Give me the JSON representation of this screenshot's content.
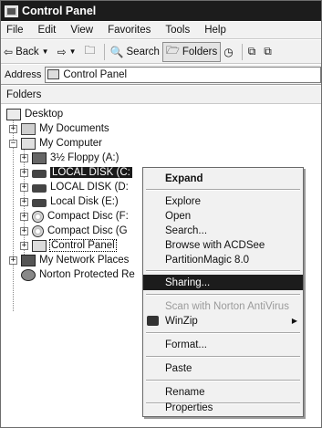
{
  "window": {
    "title": "Control Panel"
  },
  "menubar": {
    "items": [
      "File",
      "Edit",
      "View",
      "Favorites",
      "Tools",
      "Help"
    ]
  },
  "toolbar": {
    "back": "Back",
    "search": "Search",
    "folders": "Folders"
  },
  "address": {
    "label": "Address",
    "value": "Control Panel"
  },
  "pane": {
    "title": "Folders"
  },
  "tree": {
    "desktop": "Desktop",
    "my_documents": "My Documents",
    "my_computer": "My Computer",
    "floppy": "3½ Floppy (A:)",
    "local_c": "LOCAL DISK (C:",
    "local_d": "LOCAL DISK (D:",
    "local_e": "Local Disk (E:)",
    "cd_f": "Compact Disc (F:",
    "cd_g": "Compact Disc (G",
    "control_panel": "Control Panel",
    "network": "My Network Places",
    "norton": "Norton Protected Re"
  },
  "context_menu": {
    "expand": "Expand",
    "explore": "Explore",
    "open": "Open",
    "search": "Search...",
    "browse_acdsee": "Browse with ACDSee",
    "partition_magic": "PartitionMagic 8.0",
    "sharing": "Sharing...",
    "scan_norton": "Scan with Norton AntiVirus",
    "winzip": "WinZip",
    "format": "Format...",
    "paste": "Paste",
    "rename": "Rename",
    "properties": "Properties"
  }
}
